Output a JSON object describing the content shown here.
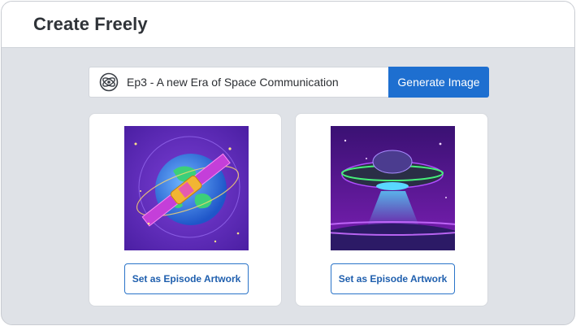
{
  "header": {
    "title": "Create Freely"
  },
  "prompt": {
    "icon": "atom-icon",
    "text": "Ep3 - A new Era of Space Communication",
    "generate_label": "Generate Image"
  },
  "results": [
    {
      "image": "satellite-earth-image",
      "button_label": "Set as Episode Artwork"
    },
    {
      "image": "ufo-planet-image",
      "button_label": "Set as Episode Artwork"
    }
  ]
}
